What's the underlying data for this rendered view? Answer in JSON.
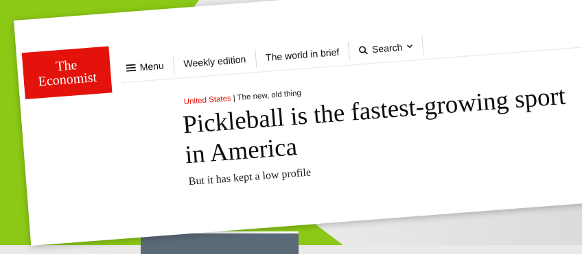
{
  "brand": {
    "line1": "The",
    "line2": "Economist",
    "color": "#e3120b"
  },
  "nav": {
    "menu_label": "Menu",
    "menu_icon": "hamburger-icon",
    "weekly_label": "Weekly edition",
    "brief_label": "The world in brief",
    "search_label": "Search",
    "search_icon": "search-icon",
    "search_caret_icon": "chevron-down-icon"
  },
  "article": {
    "section": "United States",
    "separator": "|",
    "rubric": "The new, old thing",
    "headline": "Pickleball is the fastest-growing sport in America",
    "subheadline": "But it has kept a low profile"
  },
  "colors": {
    "background_green": "#8cc916",
    "accent_red": "#e3120b"
  }
}
